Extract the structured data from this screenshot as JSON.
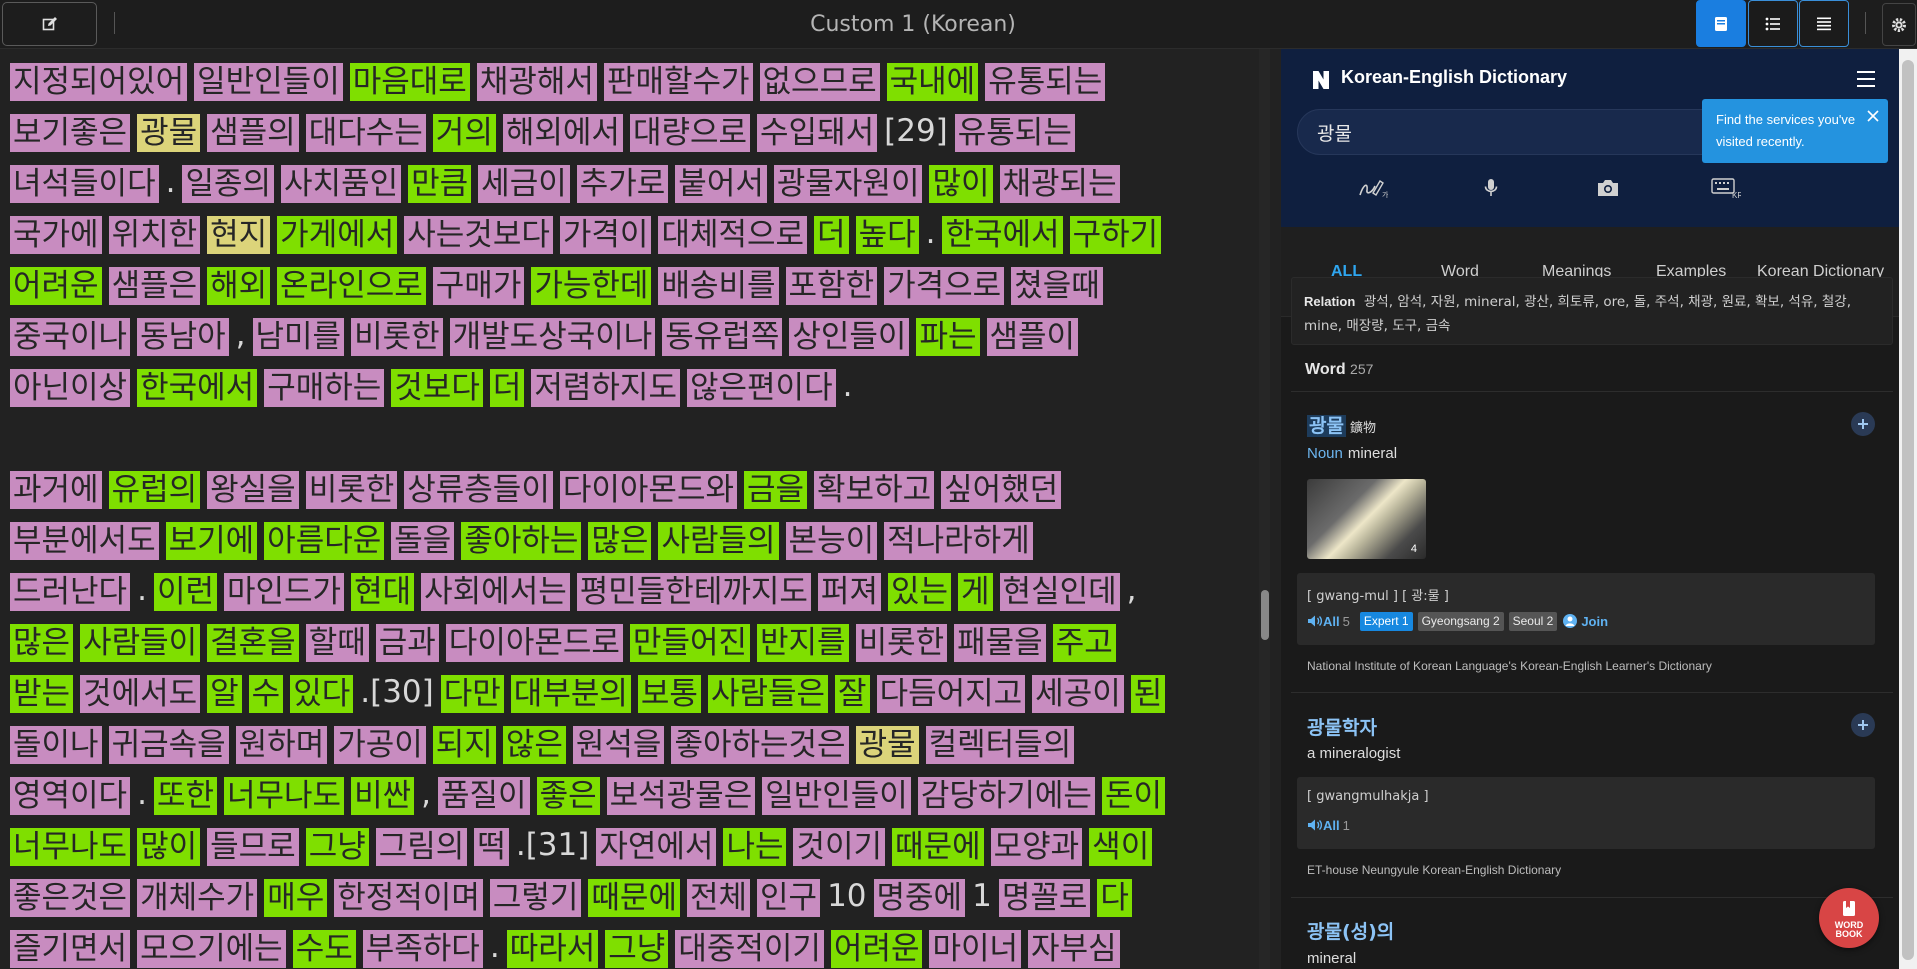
{
  "title": "Custom 1 (Korean)",
  "reader": {
    "lines": [
      [
        [
          "지정되어있어",
          "p"
        ],
        [
          "일반인들이",
          "p"
        ],
        [
          "마음대로",
          "g"
        ],
        [
          "채광해서",
          "p"
        ],
        [
          "판매할수가",
          "p"
        ],
        [
          "없으므로",
          "p"
        ],
        [
          "국내에",
          "g"
        ],
        [
          "유통되는",
          "p"
        ]
      ],
      [
        [
          "보기좋은",
          "p"
        ],
        [
          "광물",
          "y"
        ],
        [
          "샘플의",
          "p"
        ],
        [
          "대다수는",
          "p"
        ],
        [
          "거의",
          "g"
        ],
        [
          "해외에서",
          "p"
        ],
        [
          "대량으로",
          "p"
        ],
        [
          "수입돼서",
          "p"
        ],
        [
          "[29]",
          "t"
        ],
        [
          "유통되는",
          "p"
        ]
      ],
      [
        [
          "녀석들이다",
          "p"
        ],
        [
          ".",
          "t"
        ],
        [
          "일종의",
          "p"
        ],
        [
          "사치품인",
          "p"
        ],
        [
          "만큼",
          "g"
        ],
        [
          "세금이",
          "p"
        ],
        [
          "추가로",
          "p"
        ],
        [
          "붙어서",
          "p"
        ],
        [
          "광물자원이",
          "p"
        ],
        [
          "많이",
          "g"
        ],
        [
          "채광되는",
          "p"
        ]
      ],
      [
        [
          "국가에",
          "p"
        ],
        [
          "위치한",
          "p"
        ],
        [
          "현지",
          "y"
        ],
        [
          "가게에서",
          "g"
        ],
        [
          "사는것보다",
          "p"
        ],
        [
          "가격이",
          "p"
        ],
        [
          "대체적으로",
          "p"
        ],
        [
          "더",
          "g"
        ],
        [
          "높다",
          "g"
        ],
        [
          ".",
          "t"
        ],
        [
          "한국에서",
          "g"
        ],
        [
          "구하기",
          "g"
        ]
      ],
      [
        [
          "어려운",
          "g"
        ],
        [
          "샘플은",
          "p"
        ],
        [
          "해외",
          "g"
        ],
        [
          "온라인으로",
          "g"
        ],
        [
          "구매가",
          "p"
        ],
        [
          "가능한데",
          "g"
        ],
        [
          "배송비를",
          "p"
        ],
        [
          "포함한",
          "p"
        ],
        [
          "가격으로",
          "p"
        ],
        [
          "쳤을때",
          "p"
        ]
      ],
      [
        [
          "중국이나",
          "p"
        ],
        [
          "동남아",
          "p"
        ],
        [
          ",",
          "t"
        ],
        [
          "남미를",
          "p"
        ],
        [
          "비롯한",
          "p"
        ],
        [
          "개발도상국이나",
          "p"
        ],
        [
          "동유럽쪽",
          "p"
        ],
        [
          "상인들이",
          "p"
        ],
        [
          "파는",
          "g"
        ],
        [
          "샘플이",
          "p"
        ]
      ],
      [
        [
          "아닌이상",
          "p"
        ],
        [
          "한국에서",
          "g"
        ],
        [
          "구매하는",
          "p"
        ],
        [
          "것보다",
          "g"
        ],
        [
          "더",
          "g"
        ],
        [
          "저렴하지도",
          "p"
        ],
        [
          "않은편이다",
          "p"
        ],
        [
          ".",
          "t"
        ]
      ],
      [],
      [
        [
          "과거에",
          "p"
        ],
        [
          "유럽의",
          "g"
        ],
        [
          "왕실을",
          "p"
        ],
        [
          "비롯한",
          "p"
        ],
        [
          "상류층들이",
          "p"
        ],
        [
          "다이아몬드와",
          "p"
        ],
        [
          "금을",
          "g"
        ],
        [
          "확보하고",
          "p"
        ],
        [
          "싶어했던",
          "p"
        ]
      ],
      [
        [
          "부분에서도",
          "p"
        ],
        [
          "보기에",
          "g"
        ],
        [
          "아름다운",
          "g"
        ],
        [
          "돌을",
          "p"
        ],
        [
          "좋아하는",
          "g"
        ],
        [
          "많은",
          "g"
        ],
        [
          "사람들의",
          "g"
        ],
        [
          "본능이",
          "p"
        ],
        [
          "적나라하게",
          "p"
        ]
      ],
      [
        [
          "드러난다",
          "p"
        ],
        [
          ".",
          "t"
        ],
        [
          "이런",
          "g"
        ],
        [
          "마인드가",
          "p"
        ],
        [
          "현대",
          "g"
        ],
        [
          "사회에서는",
          "p"
        ],
        [
          "평민들한테까지도",
          "p"
        ],
        [
          "퍼져",
          "p"
        ],
        [
          "있는",
          "g"
        ],
        [
          "게",
          "g"
        ],
        [
          "현실인데",
          "p"
        ],
        [
          ",",
          "t"
        ]
      ],
      [
        [
          "많은",
          "g"
        ],
        [
          "사람들이",
          "g"
        ],
        [
          "결혼을",
          "g"
        ],
        [
          "할때",
          "p"
        ],
        [
          "금과",
          "p"
        ],
        [
          "다이아몬드로",
          "p"
        ],
        [
          "만들어진",
          "g"
        ],
        [
          "반지를",
          "g"
        ],
        [
          "비롯한",
          "p"
        ],
        [
          "패물을",
          "p"
        ],
        [
          "주고",
          "g"
        ]
      ],
      [
        [
          "받는",
          "g"
        ],
        [
          "것에서도",
          "p"
        ],
        [
          "알",
          "g"
        ],
        [
          "수",
          "g"
        ],
        [
          "있다",
          "g"
        ],
        [
          ".[30]",
          "t"
        ],
        [
          "다만",
          "g"
        ],
        [
          "대부분의",
          "g"
        ],
        [
          "보통",
          "g"
        ],
        [
          "사람들은",
          "g"
        ],
        [
          "잘",
          "g"
        ],
        [
          "다듬어지고",
          "p"
        ],
        [
          "세공이",
          "p"
        ],
        [
          "된",
          "g"
        ]
      ],
      [
        [
          "돌이나",
          "p"
        ],
        [
          "귀금속을",
          "p"
        ],
        [
          "원하며",
          "p"
        ],
        [
          "가공이",
          "p"
        ],
        [
          "되지",
          "g"
        ],
        [
          "않은",
          "g"
        ],
        [
          "원석을",
          "p"
        ],
        [
          "좋아하는것은",
          "p"
        ],
        [
          "광물",
          "y"
        ],
        [
          "컬렉터들의",
          "p"
        ]
      ],
      [
        [
          "영역이다",
          "p"
        ],
        [
          ".",
          "t"
        ],
        [
          "또한",
          "g"
        ],
        [
          "너무나도",
          "g"
        ],
        [
          "비싼",
          "g"
        ],
        [
          ",",
          "t"
        ],
        [
          "품질이",
          "p"
        ],
        [
          "좋은",
          "g"
        ],
        [
          "보석광물은",
          "p"
        ],
        [
          "일반인들이",
          "p"
        ],
        [
          "감당하기에는",
          "p"
        ],
        [
          "돈이",
          "g"
        ]
      ],
      [
        [
          "너무나도",
          "g"
        ],
        [
          "많이",
          "g"
        ],
        [
          "들므로",
          "p"
        ],
        [
          "그냥",
          "g"
        ],
        [
          "그림의",
          "p"
        ],
        [
          "떡",
          "p"
        ],
        [
          ".[31]",
          "t"
        ],
        [
          "자연에서",
          "p"
        ],
        [
          "나는",
          "g"
        ],
        [
          "것이기",
          "p"
        ],
        [
          "때문에",
          "g"
        ],
        [
          "모양과",
          "p"
        ],
        [
          "색이",
          "g"
        ]
      ],
      [
        [
          "좋은것은",
          "p"
        ],
        [
          "개체수가",
          "p"
        ],
        [
          "매우",
          "g"
        ],
        [
          "한정적이며",
          "p"
        ],
        [
          "그렇기",
          "p"
        ],
        [
          "때문에",
          "g"
        ],
        [
          "전체",
          "p"
        ],
        [
          "인구",
          "p"
        ],
        [
          "10",
          "t"
        ],
        [
          "명중에",
          "p"
        ],
        [
          "1",
          "t"
        ],
        [
          "명꼴로",
          "p"
        ],
        [
          "다",
          "g"
        ]
      ],
      [
        [
          "즐기면서",
          "p"
        ],
        [
          "모으기에는",
          "p"
        ],
        [
          "수도",
          "g"
        ],
        [
          "부족하다",
          "p"
        ],
        [
          ".",
          "t"
        ],
        [
          "따라서",
          "g"
        ],
        [
          "그냥",
          "g"
        ],
        [
          "대중적이기",
          "p"
        ],
        [
          "어려운",
          "g"
        ],
        [
          "마이너",
          "p"
        ],
        [
          "자부심",
          "p"
        ]
      ]
    ]
  },
  "dictionary": {
    "title": "Korean-English Dictionary",
    "search_value": "광물",
    "tooltip": "Find the services you've visited recently.",
    "tabs": [
      "ALL",
      "Word",
      "Meanings",
      "Examples",
      "Korean Dictionary"
    ],
    "relation_label": "Relation",
    "relation_text": "광석, 암석, 자원, mineral, 광산, 희토류, ore, 돌, 주석, 채광, 원료, 확보, 석유, 철강, mine, 매장량, 도구, 금속",
    "word_section_label": "Word",
    "word_section_count": "257",
    "entries": [
      {
        "word": "광물",
        "hanja": "鑛物",
        "pos": "Noun",
        "meaning": "mineral",
        "image_count": "4",
        "pron": "[ gwang-mul ]   [ 광:물 ]",
        "all_label": "All",
        "all_count": "5",
        "tags": [
          "Expert 1",
          "Gyeongsang 2",
          "Seoul 2"
        ],
        "join_label": "Join",
        "source": "National Institute of Korean Language's Korean-English Learner's Dictionary"
      },
      {
        "word": "광물학자",
        "meaning": "a mineralogist",
        "pron": "[ gwangmulhakja ]",
        "all_label": "All",
        "all_count": "1",
        "source": "ET-house Neungyule Korean-English Dictionary"
      },
      {
        "word": "광물(성)의",
        "meaning": "mineral"
      }
    ],
    "wordbook_label_1": "WORD",
    "wordbook_label_2": "BOOK"
  },
  "colors": {
    "highlight_pink": "#c88cc0",
    "highlight_green": "#7fdf00",
    "highlight_yellow": "#dcd47a",
    "accent_blue": "#1a7ee0",
    "dict_header": "#0f1f3f"
  },
  "icons": [
    "edit-icon",
    "book-view-icon",
    "list-view-icon",
    "text-view-icon",
    "settings-gear-icon",
    "handwriting-icon",
    "microphone-icon",
    "camera-icon",
    "korean-keyboard-icon",
    "menu-icon",
    "close-icon",
    "speaker-icon",
    "plus-icon",
    "wordbook-icon"
  ]
}
